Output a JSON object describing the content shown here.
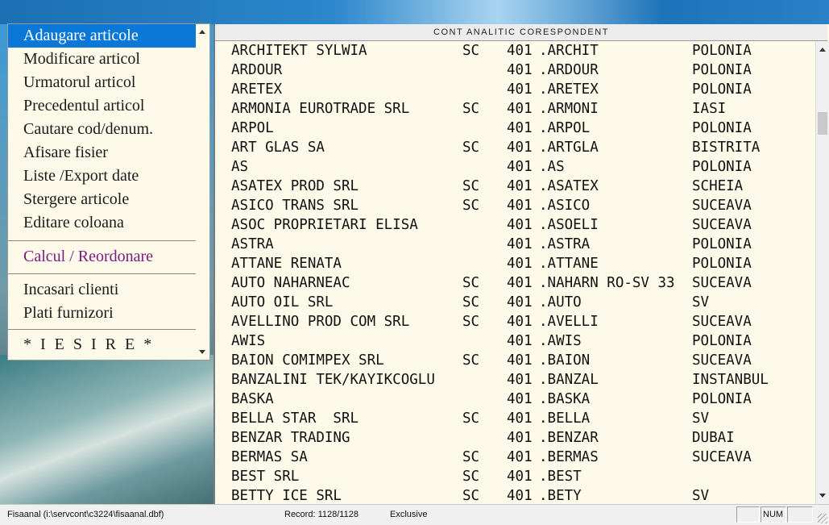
{
  "menu": {
    "items": [
      {
        "label": "Adaugare articole",
        "selected": true
      },
      {
        "label": "Modificare articol"
      },
      {
        "label": "Urmatorul articol"
      },
      {
        "label": "Precedentul articol"
      },
      {
        "label": "Cautare cod/denum."
      },
      {
        "label": "Afisare fisier"
      },
      {
        "label": "Liste /Export date"
      },
      {
        "label": "Stergere articole"
      },
      {
        "label": "Editare coloana"
      }
    ],
    "calc_label": "Calcul / Reordonare",
    "finance_items": [
      {
        "label": "Incasari clienti"
      },
      {
        "label": "Plati furnizori"
      }
    ],
    "exit_label": "* I E S I R E *"
  },
  "grid": {
    "header": "CONT ANALITIC CORESPONDENT",
    "rows": [
      {
        "name": "ARCHITEKT SYLWIA",
        "sc": "SC",
        "account": "401",
        "code": ".ARCHIT",
        "city": "POLONIA"
      },
      {
        "name": "ARDOUR",
        "sc": "",
        "account": "401",
        "code": ".ARDOUR",
        "city": "POLONIA"
      },
      {
        "name": "ARETEX",
        "sc": "",
        "account": "401",
        "code": ".ARETEX",
        "city": "POLONIA"
      },
      {
        "name": "ARMONIA EUROTRADE SRL",
        "sc": "SC",
        "account": "401",
        "code": ".ARMONI",
        "city": "IASI"
      },
      {
        "name": "ARPOL",
        "sc": "",
        "account": "401",
        "code": ".ARPOL",
        "city": "POLONIA"
      },
      {
        "name": "ART GLAS SA",
        "sc": "SC",
        "account": "401",
        "code": ".ARTGLA",
        "city": "BISTRITA"
      },
      {
        "name": "AS",
        "sc": "",
        "account": "401",
        "code": ".AS",
        "city": "POLONIA"
      },
      {
        "name": "ASATEX PROD SRL",
        "sc": "SC",
        "account": "401",
        "code": ".ASATEX",
        "city": "SCHEIA"
      },
      {
        "name": "ASICO TRANS SRL",
        "sc": "SC",
        "account": "401",
        "code": ".ASICO",
        "city": "SUCEAVA"
      },
      {
        "name": "ASOC PROPRIETARI ELISA",
        "sc": "",
        "account": "401",
        "code": ".ASOELI",
        "city": "SUCEAVA"
      },
      {
        "name": "ASTRA",
        "sc": "",
        "account": "401",
        "code": ".ASTRA",
        "city": "POLONIA"
      },
      {
        "name": "ATTANE RENATA",
        "sc": "",
        "account": "401",
        "code": ".ATTANE",
        "city": "POLONIA"
      },
      {
        "name": "AUTO NAHARNEAC",
        "sc": "SC",
        "account": "401",
        "code": ".NAHARN RO-SV 33",
        "city": "SUCEAVA"
      },
      {
        "name": "AUTO OIL SRL",
        "sc": "SC",
        "account": "401",
        "code": ".AUTO",
        "city": "SV"
      },
      {
        "name": "AVELLINO PROD COM SRL",
        "sc": "SC",
        "account": "401",
        "code": ".AVELLI",
        "city": "SUCEAVA"
      },
      {
        "name": "AWIS",
        "sc": "",
        "account": "401",
        "code": ".AWIS",
        "city": "POLONIA"
      },
      {
        "name": "BAION COMIMPEX SRL",
        "sc": "SC",
        "account": "401",
        "code": ".BAION",
        "city": "SUCEAVA"
      },
      {
        "name": "BANZALINI TEK/KAYIKCOGLU",
        "sc": "",
        "account": "401",
        "code": ".BANZAL",
        "city": "INSTANBUL"
      },
      {
        "name": "BASKA",
        "sc": "",
        "account": "401",
        "code": ".BASKA",
        "city": "POLONIA"
      },
      {
        "name": "BELLA STAR  SRL",
        "sc": "SC",
        "account": "401",
        "code": ".BELLA",
        "city": "SV"
      },
      {
        "name": "BENZAR TRADING",
        "sc": "",
        "account": "401",
        "code": ".BENZAR",
        "city": "DUBAI"
      },
      {
        "name": "BERMAS SA",
        "sc": "SC",
        "account": "401",
        "code": ".BERMAS",
        "city": "SUCEAVA"
      },
      {
        "name": "BEST SRL",
        "sc": "SC",
        "account": "401",
        "code": ".BEST",
        "city": ""
      },
      {
        "name": "BETTY ICE SRL",
        "sc": "SC",
        "account": "401",
        "code": ".BETY",
        "city": "SV"
      }
    ]
  },
  "status": {
    "file": "Fisaanal (i:\\servcont\\c3224\\fisaanal.dbf)",
    "record": "Record: 1128/1128",
    "mode": "Exclusive",
    "num": "NUM"
  }
}
